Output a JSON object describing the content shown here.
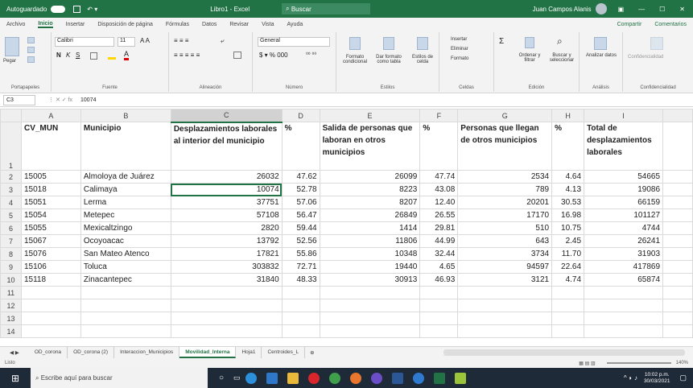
{
  "window": {
    "title": "Libro1 - Excel",
    "autosave": "Autoguardado",
    "user": "Juan Campos Alanis",
    "search_placeholder": "Buscar"
  },
  "menu": [
    "Archivo",
    "Inicio",
    "Insertar",
    "Disposición de página",
    "Fórmulas",
    "Datos",
    "Revisar",
    "Vista",
    "Ayuda"
  ],
  "share": "Compartir",
  "comments": "Comentarios",
  "ribbon": {
    "paste": "Pegar",
    "font_name": "Calibri",
    "font_size": "11",
    "number_format": "General",
    "groups": [
      "Portapapeles",
      "Fuente",
      "Alineación",
      "Número",
      "Estilos",
      "Celdas",
      "Edición",
      "Análisis",
      "Confidencialidad"
    ],
    "conditional": "Formato condicional",
    "table_fmt": "Dar formato como tabla",
    "cell_styles": "Estilos de celda",
    "insert": "Insertar",
    "delete": "Eliminar",
    "format": "Formato",
    "sort": "Ordenar y filtrar",
    "find": "Buscar y seleccionar",
    "analyze": "Analizar datos",
    "sensitivity": "Confidencialidad"
  },
  "formula": {
    "cell": "C3",
    "value": "10074"
  },
  "columns": [
    "A",
    "B",
    "C",
    "D",
    "E",
    "F",
    "G",
    "H",
    "I"
  ],
  "headers": [
    "CV_MUN",
    "Municipio",
    "Desplazamientos laborales al interior del municipio",
    "%",
    "Salida de personas que laboran en otros municipios",
    "%",
    "Personas que llegan de otros municipios",
    "%",
    "Total de desplazamientos laborales"
  ],
  "rows": [
    [
      "15005",
      "Almoloya de Juárez",
      "26032",
      "47.62",
      "26099",
      "47.74",
      "2534",
      "4.64",
      "54665"
    ],
    [
      "15018",
      "Calimaya",
      "10074",
      "52.78",
      "8223",
      "43.08",
      "789",
      "4.13",
      "19086"
    ],
    [
      "15051",
      "Lerma",
      "37751",
      "57.06",
      "8207",
      "12.40",
      "20201",
      "30.53",
      "66159"
    ],
    [
      "15054",
      "Metepec",
      "57108",
      "56.47",
      "26849",
      "26.55",
      "17170",
      "16.98",
      "101127"
    ],
    [
      "15055",
      "Mexicaltzingo",
      "2820",
      "59.44",
      "1414",
      "29.81",
      "510",
      "10.75",
      "4744"
    ],
    [
      "15067",
      "Ocoyoacac",
      "13792",
      "52.56",
      "11806",
      "44.99",
      "643",
      "2.45",
      "26241"
    ],
    [
      "15076",
      "San Mateo Atenco",
      "17821",
      "55.86",
      "10348",
      "32.44",
      "3734",
      "11.70",
      "31903"
    ],
    [
      "15106",
      "Toluca",
      "303832",
      "72.71",
      "19440",
      "4.65",
      "94597",
      "22.64",
      "417869"
    ],
    [
      "15118",
      "Zinacantepec",
      "31840",
      "48.33",
      "30913",
      "46.93",
      "3121",
      "4.74",
      "65874"
    ]
  ],
  "sheets": [
    "OD_corona",
    "OD_corona (2)",
    "Interaccion_Municipios",
    "Movilidad_Interna",
    "Hoja1",
    "Centroides_L"
  ],
  "active_sheet": "Movilidad_Interna",
  "status": {
    "ready": "Listo",
    "zoom": "140%"
  },
  "taskbar": {
    "search": "Escribe aquí para buscar",
    "time": "10:02 p.m.",
    "date": "30/03/2021"
  },
  "colors": {
    "excel_green": "#217346",
    "taskbar": "#1f2a38"
  }
}
